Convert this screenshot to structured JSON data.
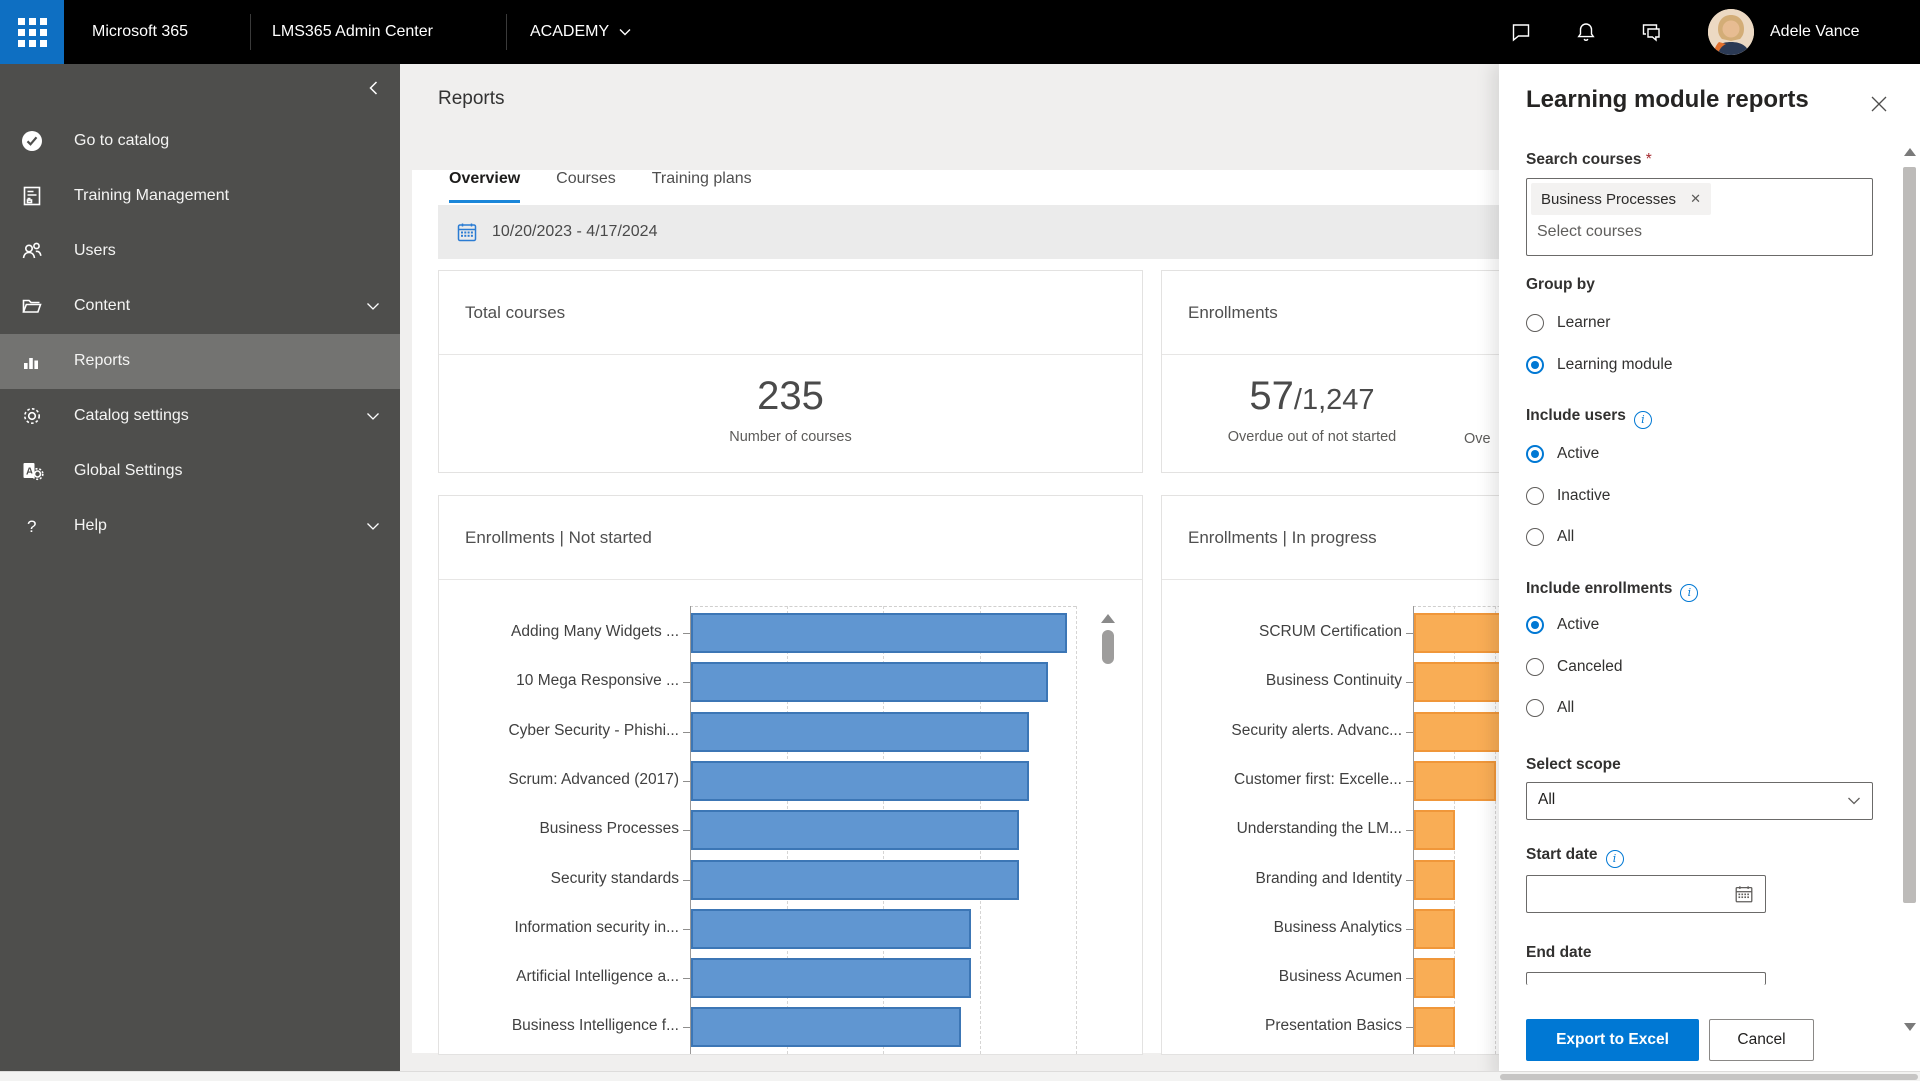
{
  "topbar": {
    "brand": "Microsoft 365",
    "app": "LMS365 Admin Center",
    "tenant": "ACADEMY",
    "user": "Adele Vance",
    "icons": [
      "chat-icon",
      "bell-icon",
      "feedback-icon"
    ]
  },
  "sidebar": {
    "items": [
      {
        "label": "Go to catalog",
        "icon": "catalog-check-icon",
        "selected": false,
        "chevron": false
      },
      {
        "label": "Training Management",
        "icon": "training-management-icon",
        "selected": false,
        "chevron": false
      },
      {
        "label": "Users",
        "icon": "users-icon",
        "selected": false,
        "chevron": false
      },
      {
        "label": "Content",
        "icon": "folder-icon",
        "selected": false,
        "chevron": true
      },
      {
        "label": "Reports",
        "icon": "bar-chart-icon",
        "selected": true,
        "chevron": false
      },
      {
        "label": "Catalog settings",
        "icon": "gear-icon",
        "selected": false,
        "chevron": true
      },
      {
        "label": "Global Settings",
        "icon": "global-settings-icon",
        "selected": false,
        "chevron": false
      },
      {
        "label": "Help",
        "icon": "help-icon",
        "selected": false,
        "chevron": true
      }
    ]
  },
  "page": {
    "title": "Reports",
    "tabs": [
      {
        "label": "Overview",
        "active": true
      },
      {
        "label": "Courses",
        "active": false
      },
      {
        "label": "Training plans",
        "active": false
      }
    ],
    "date_range": "10/20/2023 - 4/17/2024"
  },
  "summary": {
    "total": {
      "title": "Total courses",
      "value": "235",
      "label": "Number of courses"
    },
    "enroll": {
      "title": "Enrollments",
      "value": "57",
      "total": "/1,247",
      "label": "Overdue out of not started",
      "partial_next_label": "Ove"
    }
  },
  "chart_data": [
    {
      "type": "bar",
      "orientation": "horizontal",
      "title": "Enrollments | Not started",
      "categories": [
        "Adding Many Widgets ...",
        "10 Mega Responsive ...",
        "Cyber Security - Phishi...",
        "Scrum: Advanced (2017)",
        "Business Processes",
        "Security standards",
        "Information security in...",
        "Artificial Intelligence a...",
        "Business Intelligence f..."
      ],
      "values": [
        39,
        37,
        35,
        35,
        34,
        34,
        29,
        29,
        28
      ],
      "xmax": 40,
      "grid_step": 10,
      "grid": true,
      "bar_color": "#6096d1",
      "bar_border": "#3c76b5",
      "has_scroll_indicator": true
    },
    {
      "type": "bar",
      "orientation": "horizontal",
      "title": "Enrollments | In progress",
      "categories": [
        "SCRUM Certification",
        "Business Continuity",
        "Security alerts. Advanc...",
        "Customer first: Excelle...",
        "Understanding the LM...",
        "Branding and Identity",
        "Business Analytics",
        "Business Acumen",
        "Presentation Basics"
      ],
      "values": [
        14,
        13,
        12,
        10,
        5,
        5,
        5,
        5,
        5
      ],
      "xmax": 47,
      "grid_step": 5,
      "grid": true,
      "bar_color": "#f9ad55",
      "bar_border": "#f0973a",
      "has_scroll_indicator": false
    }
  ],
  "panel": {
    "title": "Learning module reports",
    "search_label": "Search courses",
    "required_mark": "*",
    "chip": "Business Processes",
    "placeholder": "Select courses",
    "groups": [
      {
        "label": "Group by",
        "info": false,
        "options": [
          {
            "label": "Learner",
            "selected": false
          },
          {
            "label": "Learning module",
            "selected": true
          }
        ]
      },
      {
        "label": "Include users",
        "info": true,
        "options": [
          {
            "label": "Active",
            "selected": true
          },
          {
            "label": "Inactive",
            "selected": false
          },
          {
            "label": "All",
            "selected": false
          }
        ]
      },
      {
        "label": "Include enrollments",
        "info": true,
        "options": [
          {
            "label": "Active",
            "selected": true
          },
          {
            "label": "Canceled",
            "selected": false
          },
          {
            "label": "All",
            "selected": false
          }
        ]
      }
    ],
    "scope_label": "Select scope",
    "scope_value": "All",
    "start_date_label": "Start date",
    "end_date_label": "End date",
    "start_date_value": "",
    "end_date_value": "",
    "export_label": "Export to Excel",
    "cancel_label": "Cancel"
  },
  "colors": {
    "accent": "#0078d4",
    "waffle": "#0e6fc2",
    "tab_underline": "#1a86d9",
    "sidebar_bg": "#4e4e4c",
    "sidebar_selected": "#737371",
    "bar_blue": "#6096d1",
    "bar_orange": "#f9ad55"
  }
}
